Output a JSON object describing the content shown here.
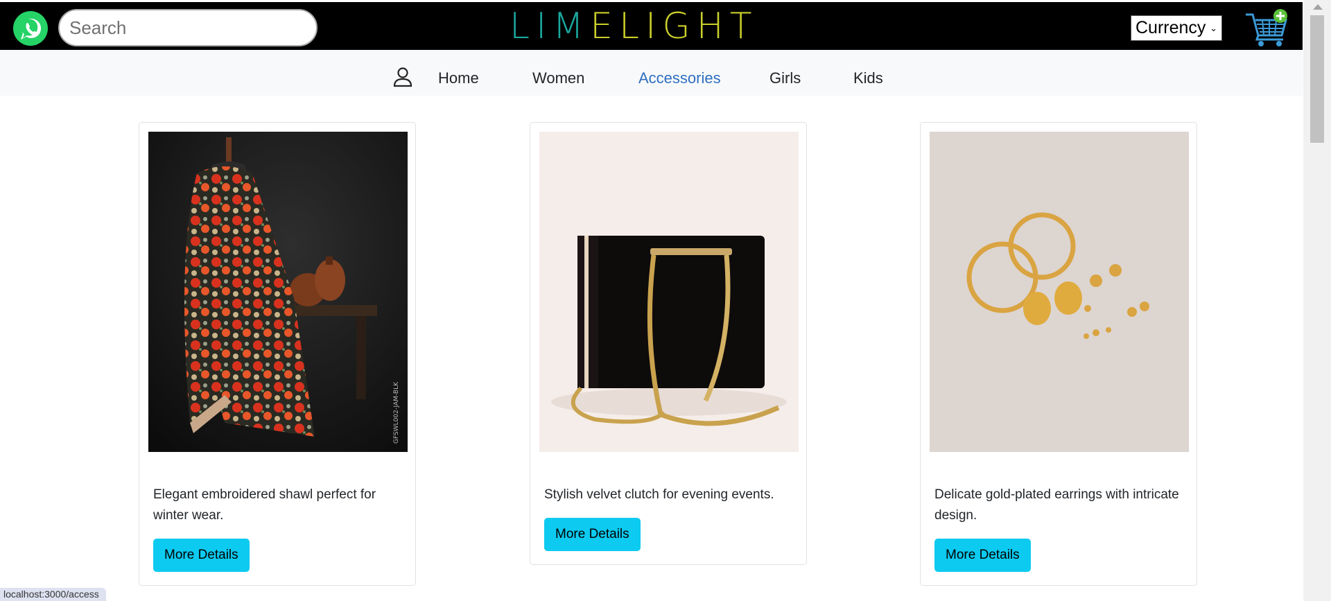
{
  "header": {
    "search_placeholder": "Search",
    "logo_part1": "LIM",
    "logo_part2": "ELIGHT",
    "currency_label": "Currency",
    "whatsapp_icon": "whatsapp-icon",
    "cart_icon": "cart-add-icon"
  },
  "nav": {
    "items": [
      {
        "label": "Home"
      },
      {
        "label": "Women"
      },
      {
        "label": "Accessories"
      },
      {
        "label": "Girls"
      },
      {
        "label": "Kids"
      }
    ],
    "active": "Accessories",
    "active_color": "#2f6fc0"
  },
  "products": [
    {
      "description": "Elegant embroidered shawl perfect for winter wear.",
      "button": "More Details",
      "image_label": "GFSWL002-JAM-BLK"
    },
    {
      "description": "Stylish velvet clutch for evening events.",
      "button": "More Details"
    },
    {
      "description": "Delicate gold-plated earrings with intricate design.",
      "button": "More Details"
    }
  ],
  "status_bar": "localhost:3000/access",
  "colors": {
    "button": "#0dcaf0",
    "logo_teal": "#1aa89e",
    "logo_lime": "#c9cf2a"
  }
}
